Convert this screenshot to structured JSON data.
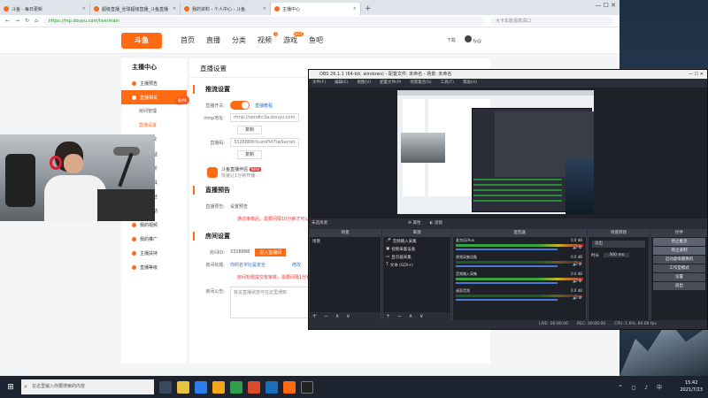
{
  "browser": {
    "tabs": [
      {
        "label": "斗鱼 - 每日更新"
      },
      {
        "label": "超级直播_全球超级直播_斗鱼直播"
      },
      {
        "label": "我的资料 - 个人中心 - 斗鱼"
      },
      {
        "label": "主播中心"
      }
    ],
    "new_tab": "+",
    "url": "https://mp.douyu.com/live/main",
    "search_placeholder": "大卡车能混高清口",
    "window_controls": "—  ☐  ✕"
  },
  "site": {
    "logo": "斗鱼",
    "nav": [
      "首页",
      "直播",
      "分类",
      "视频",
      "游戏",
      "鱼吧"
    ],
    "nav_badges": {
      "视频": "5",
      "游戏": "HOT"
    },
    "download": "下载",
    "user": "fy@"
  },
  "sidebar": {
    "title": "主播中心",
    "items": [
      {
        "label": "主播预告",
        "active": false
      },
      {
        "label": "直播相关",
        "active": true
      }
    ],
    "subitems": [
      {
        "label": "房间管理",
        "active": false
      },
      {
        "label": "直播设置",
        "active": true
      },
      {
        "label": "直播回放",
        "active": false
      }
    ],
    "more_items": [
      {
        "label": "分成收益"
      },
      {
        "label": "直播分析"
      },
      {
        "label": "直播工具"
      },
      {
        "label": "我的粉丝"
      },
      {
        "label": "商业活动"
      },
      {
        "label": "我的视频"
      },
      {
        "label": "我的推广"
      },
      {
        "label": "主播扶持"
      },
      {
        "label": "直播等级"
      }
    ],
    "fan_badge": "粉丝"
  },
  "main": {
    "title": "直播设置",
    "stream_section": "推流设置",
    "stream_switch_label": "直播开关:",
    "stream_help_link": "直播教程",
    "rtmp_label": "rtmp地址:",
    "rtmp_value": "rtmp://sendtc3a.douyu.com",
    "copy_btn": "复制",
    "code_label": "直播码:",
    "code_value": "3328888rfsumPi47twSecret",
    "copy_btn2": "复制",
    "promo_title": "斗鱼直播伴侣",
    "promo_new": "NEW",
    "promo_sub": "快速让1分钟开播",
    "preview_section": "直播预告",
    "preview_label": "直播预告:",
    "preview_value": "设置预告",
    "preview_warn": "通过审核后，需要间隔10分钟才可以修改",
    "room_section": "房间设置",
    "room_id_label": "房间ID:",
    "room_id": "3328888",
    "enter_room_btn": "进入直播间",
    "room_title_label": "房间标题:",
    "room_title": "你的名字比是安全",
    "edit_link": "修改",
    "room_title_warn": "房间标题提交有审核，需要间隔1分钟",
    "notice_label": "房间公告:",
    "notice_placeholder": "有关直播状态可在这里通知"
  },
  "obs": {
    "title": "OBS 26.1.1 (64-bit, windows) - 配置文件: 未命名 - 场景: 未命名",
    "menu": [
      "文件(F)",
      "编辑(E)",
      "视图(V)",
      "配置文件(P)",
      "场景集合(S)",
      "工具(T)",
      "帮助(H)"
    ],
    "window_controls": "—  ☐  ✕",
    "source_bar": "未选择源",
    "properties_btn": "属性",
    "filters_btn": "滤镜",
    "docks": {
      "scenes": "场景",
      "sources": "来源",
      "mixer": "混音器",
      "transitions": "场景转场",
      "controls": "控件"
    },
    "scene_items": [
      "场景"
    ],
    "source_items": [
      "音频输入采集",
      "视频采集设备",
      "显示器采集",
      "文本 (GDI+)"
    ],
    "mixer_channels": [
      {
        "name": "麦克风/Aux",
        "db": "0.0 dB",
        "level": 0.75
      },
      {
        "name": "视频采集设备",
        "db": "0.0 dB",
        "level": 0.1
      },
      {
        "name": "音频输入采集",
        "db": "0.0 dB",
        "level": 0.6
      },
      {
        "name": "桌面音频",
        "db": "0.0 dB",
        "level": 0.1
      }
    ],
    "transition_type": "淡出",
    "duration_label": "时长",
    "duration_value": "300 ms",
    "controls": [
      "停止推流",
      "停止录制",
      "启动虚拟摄像机",
      "工作室模式",
      "设置",
      "退出"
    ],
    "status": [
      "LIVE: 00:00:00",
      "REC: 00:00:00",
      "CPU: 1.6%, 60.00 fps"
    ],
    "dock_foot": "+ − ∧ ∨"
  },
  "taskbar": {
    "start": "⊞",
    "search_placeholder": "在这里输入你要搜索的内容",
    "time": "15:42",
    "date": "2021/7/23",
    "tray_icons": "^ ◻ ♪ 中"
  },
  "icons": {
    "browser_back": "arrow-left-icon",
    "browser_forward": "arrow-right-icon",
    "browser_refresh": "refresh-icon",
    "home": "home-icon",
    "obs_gear": "gear-icon",
    "speaker": "speaker-icon"
  },
  "colors": {
    "brand": "#ff6a13",
    "obs_bg": "#2b2e38",
    "meter_green": "#34a53f"
  }
}
